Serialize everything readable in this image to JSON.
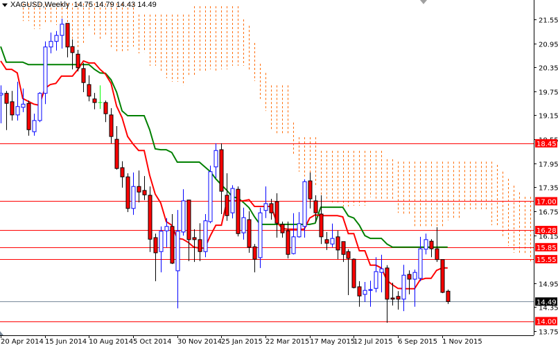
{
  "header": {
    "symbol": "XAGUSD,Weekly",
    "ohlc": "14.75 14.79 14.43 14.49"
  },
  "colors": {
    "bull": "#0000ff",
    "bear_fill": "#ff0000",
    "doji": "#00ff00",
    "tenkan": "#ff0000",
    "kijun": "#008000",
    "cloud": "#ff6a00",
    "level": "#ff0000",
    "current": "#778899"
  },
  "chart_data": {
    "type": "candlestick",
    "title": "XAGUSD,Weekly",
    "ylim": [
      13.75,
      21.55
    ],
    "y_ticks": [
      "21.55",
      "20.95",
      "20.35",
      "19.75",
      "19.15",
      "18.55",
      "17.95",
      "17.35",
      "16.75",
      "16.15",
      "14.95",
      "14.35",
      "13.75"
    ],
    "x_labels": [
      {
        "index": 0,
        "label": "20 Apr 2014"
      },
      {
        "index": 8,
        "label": "15 Jun 2014"
      },
      {
        "index": 16,
        "label": "10 Aug 2014"
      },
      {
        "index": 24,
        "label": "5 Oct 2014"
      },
      {
        "index": 32,
        "label": "30 Nov 2014"
      },
      {
        "index": 40,
        "label": "25 Jan 2015"
      },
      {
        "index": 48,
        "label": "22 Mar 2015"
      },
      {
        "index": 56,
        "label": "17 May 2015"
      },
      {
        "index": 64,
        "label": "12 Jul 2015"
      },
      {
        "index": 72,
        "label": "6 Sep 2015"
      },
      {
        "index": 80,
        "label": "1 Nov 2015"
      }
    ],
    "candles_ohlc": [
      [
        19.66,
        19.9,
        18.95,
        19.7
      ],
      [
        19.7,
        19.76,
        18.78,
        19.45
      ],
      [
        19.49,
        19.76,
        19.02,
        19.16
      ],
      [
        19.16,
        19.99,
        19.02,
        19.37
      ],
      [
        19.35,
        19.82,
        19.23,
        19.43
      ],
      [
        19.45,
        19.52,
        18.64,
        18.79
      ],
      [
        18.74,
        19.19,
        18.64,
        19.02
      ],
      [
        19.02,
        19.73,
        18.98,
        19.7
      ],
      [
        19.7,
        21.0,
        19.43,
        20.86
      ],
      [
        20.86,
        21.22,
        20.7,
        21.0
      ],
      [
        21.0,
        21.26,
        20.77,
        21.15
      ],
      [
        21.15,
        21.57,
        20.82,
        21.43
      ],
      [
        21.45,
        21.45,
        20.6,
        20.86
      ],
      [
        20.87,
        21.05,
        20.3,
        20.72
      ],
      [
        20.68,
        20.79,
        20.25,
        20.34
      ],
      [
        20.32,
        20.46,
        19.73,
        19.97
      ],
      [
        19.92,
        20.15,
        19.5,
        19.63
      ],
      [
        19.56,
        19.71,
        19.3,
        19.47
      ],
      [
        19.47,
        19.9,
        19.31,
        19.47
      ],
      [
        19.47,
        19.52,
        18.98,
        19.19
      ],
      [
        19.16,
        19.33,
        18.45,
        18.62
      ],
      [
        18.55,
        18.88,
        17.79,
        17.82
      ],
      [
        17.84,
        18.0,
        17.34,
        17.61
      ],
      [
        17.61,
        17.7,
        16.73,
        16.82
      ],
      [
        16.82,
        17.72,
        16.66,
        17.37
      ],
      [
        17.37,
        17.77,
        16.97,
        17.23
      ],
      [
        17.27,
        17.63,
        17.03,
        17.16
      ],
      [
        17.15,
        17.37,
        15.73,
        16.05
      ],
      [
        16.09,
        16.19,
        15.0,
        15.71
      ],
      [
        15.74,
        16.37,
        15.22,
        16.25
      ],
      [
        16.26,
        16.58,
        15.85,
        16.37
      ],
      [
        16.37,
        16.68,
        15.43,
        15.45
      ],
      [
        15.26,
        16.78,
        14.32,
        16.25
      ],
      [
        16.23,
        17.3,
        16.14,
        17.01
      ],
      [
        17.03,
        17.03,
        15.5,
        16.04
      ],
      [
        16.09,
        16.3,
        15.48,
        16.04
      ],
      [
        16.04,
        16.45,
        15.5,
        15.74
      ],
      [
        15.74,
        16.68,
        15.6,
        16.51
      ],
      [
        16.49,
        17.89,
        16.45,
        17.74
      ],
      [
        17.86,
        18.45,
        17.58,
        18.27
      ],
      [
        18.29,
        18.45,
        16.68,
        17.25
      ],
      [
        17.15,
        17.7,
        16.51,
        16.64
      ],
      [
        16.71,
        17.4,
        16.57,
        17.32
      ],
      [
        17.3,
        17.37,
        16.12,
        16.19
      ],
      [
        16.21,
        16.84,
        16.04,
        16.59
      ],
      [
        16.54,
        16.75,
        15.71,
        15.85
      ],
      [
        15.86,
        15.93,
        15.22,
        15.55
      ],
      [
        15.59,
        16.84,
        15.33,
        16.71
      ],
      [
        16.77,
        17.37,
        16.58,
        16.94
      ],
      [
        16.94,
        17.06,
        16.54,
        16.71
      ],
      [
        16.99,
        17.2,
        16.09,
        16.45
      ],
      [
        16.42,
        16.49,
        16.09,
        16.21
      ],
      [
        16.26,
        16.49,
        15.57,
        15.67
      ],
      [
        15.69,
        16.7,
        15.67,
        16.11
      ],
      [
        16.11,
        16.73,
        16.09,
        16.44
      ],
      [
        16.37,
        17.55,
        16.09,
        17.49
      ],
      [
        17.51,
        17.72,
        16.82,
        17.06
      ],
      [
        17.01,
        17.15,
        16.49,
        16.71
      ],
      [
        16.68,
        17.15,
        15.93,
        16.11
      ],
      [
        16.04,
        16.23,
        15.78,
        15.95
      ],
      [
        15.93,
        16.44,
        15.85,
        16.07
      ],
      [
        16.11,
        16.26,
        15.55,
        15.78
      ],
      [
        15.99,
        15.99,
        15.48,
        15.67
      ],
      [
        15.74,
        15.8,
        14.65,
        15.57
      ],
      [
        15.55,
        15.57,
        14.82,
        14.84
      ],
      [
        14.86,
        15.0,
        14.36,
        14.63
      ],
      [
        14.67,
        14.98,
        14.48,
        14.77
      ],
      [
        14.77,
        15.01,
        14.36,
        14.79
      ],
      [
        14.82,
        15.6,
        14.72,
        15.24
      ],
      [
        15.22,
        15.66,
        14.72,
        15.31
      ],
      [
        15.33,
        15.4,
        13.96,
        14.55
      ],
      [
        14.58,
        14.96,
        14.39,
        14.55
      ],
      [
        14.62,
        14.75,
        14.29,
        14.55
      ],
      [
        14.55,
        15.41,
        14.25,
        15.15
      ],
      [
        15.17,
        15.27,
        14.67,
        15.05
      ],
      [
        15.05,
        15.29,
        14.36,
        15.22
      ],
      [
        15.07,
        16.11,
        15.0,
        15.81
      ],
      [
        15.8,
        16.19,
        15.67,
        16.04
      ],
      [
        16.0,
        16.05,
        15.6,
        15.81
      ],
      [
        15.81,
        16.35,
        15.48,
        15.54
      ],
      [
        15.54,
        15.54,
        14.7,
        14.72
      ],
      [
        14.75,
        14.79,
        14.43,
        14.49
      ]
    ],
    "tenkan": [
      20.51,
      20.3,
      20.3,
      20.21,
      19.57,
      19.5,
      19.43,
      19.4,
      19.82,
      19.92,
      19.95,
      20.13,
      20.13,
      20.13,
      20.3,
      20.51,
      20.46,
      20.46,
      20.3,
      20.18,
      19.95,
      19.38,
      19.09,
      18.62,
      18.43,
      18.27,
      18.27,
      17.65,
      17.18,
      16.96,
      16.49,
      16.4,
      16.07,
      16.05,
      15.97,
      15.85,
      15.83,
      15.83,
      16.14,
      16.4,
      16.4,
      17.01,
      17.01,
      17.01,
      17.01,
      17.04,
      16.87,
      16.87,
      16.87,
      16.87,
      16.49,
      16.32,
      16.3,
      16.3,
      16.3,
      16.3,
      16.58,
      16.66,
      16.64,
      16.64,
      16.64,
      16.64,
      16.61,
      16.19,
      16.19,
      15.76,
      15.76,
      15.4,
      15.4,
      15.33,
      15.02,
      14.91,
      14.82,
      14.81,
      14.81,
      14.81,
      15.03,
      15.07,
      15.07,
      15.27,
      15.33,
      15.33
    ],
    "kijun": [
      20.87,
      20.48,
      20.48,
      20.48,
      20.48,
      20.42,
      20.42,
      20.42,
      20.42,
      20.42,
      20.42,
      20.42,
      20.42,
      20.42,
      20.42,
      20.42,
      20.42,
      20.3,
      20.21,
      20.2,
      20.04,
      19.73,
      19.26,
      19.14,
      19.14,
      19.14,
      19.14,
      18.79,
      18.31,
      18.29,
      18.29,
      18.22,
      17.98,
      17.98,
      17.98,
      17.98,
      17.98,
      17.86,
      17.74,
      17.56,
      17.41,
      17.27,
      17.11,
      17.08,
      16.97,
      16.84,
      16.61,
      16.42,
      16.42,
      16.42,
      16.42,
      16.42,
      16.42,
      16.42,
      16.42,
      16.42,
      16.42,
      16.45,
      16.85,
      16.85,
      16.85,
      16.85,
      16.85,
      16.63,
      16.58,
      16.4,
      16.14,
      16.07,
      16.07,
      16.07,
      15.93,
      15.85,
      15.85,
      15.85,
      15.85,
      15.85,
      15.85,
      15.85,
      15.85,
      15.85,
      15.85,
      15.85
    ],
    "cloud_start_index": 4,
    "cloud_top": [
      21.95,
      21.95,
      21.95,
      21.95,
      21.95,
      21.95,
      21.95,
      21.95,
      21.95,
      21.95,
      21.95,
      21.95,
      21.95,
      21.95,
      21.95,
      21.95,
      21.95,
      21.95,
      21.95,
      21.95,
      21.95,
      21.67,
      21.67,
      21.67,
      21.67,
      21.67,
      21.67,
      21.67,
      21.67,
      21.67,
      21.67,
      21.88,
      21.88,
      21.88,
      21.88,
      21.88,
      21.88,
      21.88,
      21.88,
      21.88,
      21.55,
      21.39,
      20.96,
      20.44,
      20.21,
      19.9,
      19.9,
      19.9,
      19.9,
      18.97,
      18.6,
      18.6,
      18.6,
      18.6,
      18.26,
      18.26,
      18.26,
      18.26,
      18.26,
      18.26,
      18.26,
      18.26,
      18.26,
      18.26,
      18.26,
      18.26,
      18.05,
      18.05,
      17.99,
      17.99,
      17.99,
      17.99,
      17.99,
      17.99,
      17.99,
      17.99,
      17.99,
      17.99,
      17.99,
      17.99,
      17.99,
      17.99,
      17.99,
      17.99,
      17.99,
      17.99,
      17.91,
      17.74,
      17.56,
      17.39,
      17.22,
      17.11,
      17.11,
      16.75
    ],
    "cloud_bottom": [
      21.51,
      21.51,
      21.31,
      21.31,
      21.46,
      21.46,
      21.41,
      21.29,
      20.82,
      20.94,
      20.82,
      20.94,
      21.39,
      21.13,
      21.05,
      21.17,
      20.82,
      20.73,
      20.73,
      20.77,
      20.87,
      20.7,
      20.73,
      20.39,
      20.39,
      20.25,
      20.08,
      19.99,
      19.99,
      19.9,
      20.13,
      20.16,
      20.25,
      20.25,
      20.3,
      20.27,
      20.3,
      20.3,
      20.39,
      20.39,
      20.39,
      20.25,
      20.01,
      19.56,
      19.26,
      18.79,
      18.69,
      18.69,
      18.69,
      18.19,
      17.74,
      17.62,
      17.35,
      17.35,
      17.1,
      17.01,
      16.97,
      16.97,
      16.87,
      16.87,
      16.89,
      16.89,
      16.89,
      17.1,
      17.06,
      17.06,
      17.01,
      17.01,
      16.71,
      16.66,
      16.66,
      16.35,
      16.35,
      16.35,
      16.35,
      16.35,
      16.35,
      16.52,
      16.58,
      16.58,
      16.8,
      16.8,
      16.8,
      16.8,
      16.8,
      16.4,
      16.4,
      16.09,
      15.88,
      15.71,
      15.67,
      15.67,
      15.45
    ],
    "levels": [
      {
        "value": 18.45,
        "label": "18.45"
      },
      {
        "value": 17.0,
        "label": "17.00"
      },
      {
        "value": 16.28,
        "label": "16.28"
      },
      {
        "value": 15.85,
        "label": "15.85"
      },
      {
        "value": 15.55,
        "label": "15.55"
      },
      {
        "value": 14.0,
        "label": "14.00"
      }
    ],
    "current_price": {
      "value": 14.49,
      "label": "14.49"
    }
  }
}
